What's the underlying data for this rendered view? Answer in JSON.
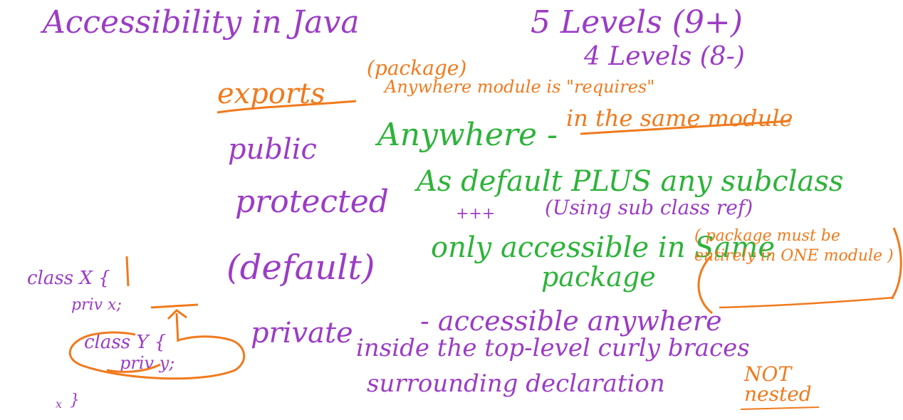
{
  "notes": {
    "title": "Accessibility in Java",
    "levels_main": "5 Levels (9+)",
    "levels_old": "4 Levels (8-)",
    "exports": {
      "keyword": "exports",
      "package_note": "(package)",
      "requires_note": "Anywhere module is \"requires\"",
      "same_module_note": "in the same module"
    },
    "public": {
      "keyword": "public",
      "desc": "Anywhere -"
    },
    "protected": {
      "keyword": "protected",
      "desc": "As default PLUS any subclass",
      "plus_marks": "+++",
      "note": "(Using sub class ref)"
    },
    "default": {
      "keyword": "(default)",
      "desc_line1": "only accessible in Same",
      "desc_line2": "package",
      "package_note": "( package must be entirely in ONE module )"
    },
    "private": {
      "keyword": "private",
      "desc_line1": "- accessible anywhere",
      "desc_line2": "inside the top-level curly braces",
      "desc_line3": "surrounding declaration",
      "not_nested": "NOT nested"
    },
    "sketch": {
      "class_x": "class X {",
      "priv_x": "priv x;",
      "class_y": "class Y {",
      "priv_y": "priv y;",
      "close_brace": "}",
      "sub_mark": "x"
    },
    "colors": {
      "purple": "#9b3cc6",
      "green": "#2db33a",
      "orange": "#f07a1d"
    }
  }
}
